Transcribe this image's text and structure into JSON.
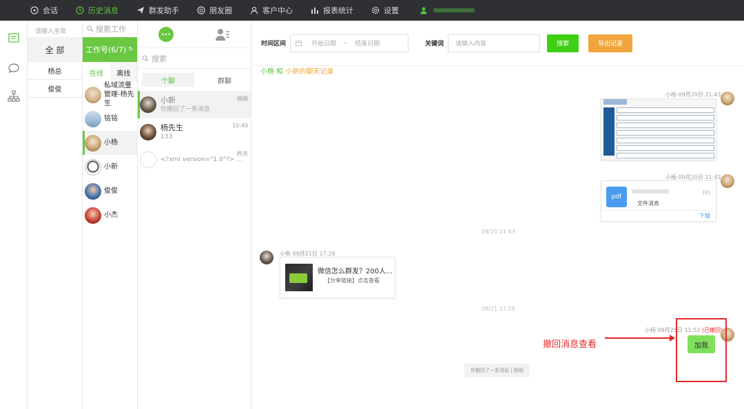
{
  "nav": {
    "items": [
      {
        "label": "会话",
        "icon": "chat-icon"
      },
      {
        "label": "历史消息",
        "icon": "clock-icon"
      },
      {
        "label": "群发助手",
        "icon": "send-icon"
      },
      {
        "label": "朋友圈",
        "icon": "moments-icon"
      },
      {
        "label": "客户中心",
        "icon": "user-icon"
      },
      {
        "label": "报表统计",
        "icon": "bar-chart-icon"
      },
      {
        "label": "设置",
        "icon": "gear-icon"
      }
    ],
    "active_index": 1,
    "accent": "#58c33a",
    "bg": "#2f3033"
  },
  "col1": {
    "search_placeholder": "请输入坐席",
    "all_label": "全 部",
    "groups": [
      "杨总",
      "俊俊"
    ]
  },
  "col2": {
    "search_placeholder": "搜索工作",
    "work_label": "工作号(6/7)",
    "tab_online": "在线",
    "tab_offline": "离线",
    "accounts": [
      {
        "name": "私域流量管理-杨先生"
      },
      {
        "name": "铭铭"
      },
      {
        "name": "小杨"
      },
      {
        "name": "小新"
      },
      {
        "name": "俊俊"
      },
      {
        "name": "小杰"
      }
    ]
  },
  "col3": {
    "search_placeholder": "搜索",
    "tab_private": "个聊",
    "tab_group": "群聊",
    "conversations": [
      {
        "name": "小新",
        "preview": "你撤回了一条消息",
        "time": "刚刚"
      },
      {
        "name": "杨先生",
        "preview": "133",
        "time": "10:49"
      },
      {
        "name": "",
        "preview": "<?xml version=\"1.0\"?> ...",
        "time": "昨天"
      }
    ]
  },
  "filter": {
    "time_label": "时间区间",
    "start_placeholder": "开始日期",
    "dash": "-",
    "end_placeholder": "结束日期",
    "keyword_label": "关键词",
    "keyword_placeholder": "请输入内容",
    "search_label": "搜索",
    "export_label": "导出记录"
  },
  "record": {
    "title_a": "小杨 和 ",
    "title_b": "小新的聊天记录",
    "messages": {
      "m1_meta": "小杨 09月20日 21:43",
      "m2_meta": "小杨 09月20日 21:43",
      "file_icon": "pdf",
      "file_count": "(0)",
      "file_label": "文件消息",
      "download": "下载",
      "sys1": "09/20 21:43",
      "m3_meta": "小新 09月21日 17:29",
      "link_title": "微信怎么群发？200人...",
      "link_desc": "【分享链接】点击查看",
      "sys2": "09/21 17:29",
      "m4_meta": "小杨 09月25日 11:52",
      "m4_recalled": "(已撤回)",
      "m4_text": "加我",
      "recall_notice": "你撤回了一条消息 | 刚刚"
    },
    "annotation": "撤回消息查看"
  }
}
